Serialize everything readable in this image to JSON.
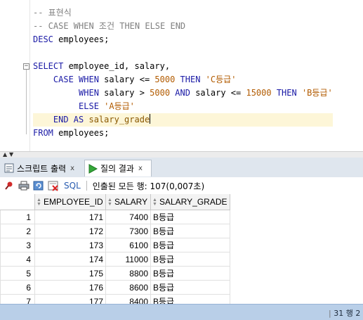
{
  "editor": {
    "lines": [
      [
        {
          "t": "-- 표현식",
          "c": "cm"
        }
      ],
      [
        {
          "t": "-- CASE WHEN 조건 THEN ELSE END",
          "c": "cm"
        }
      ],
      [
        {
          "t": "DESC",
          "c": "kw"
        },
        {
          "t": " employees;",
          "c": "id"
        }
      ],
      [],
      [
        {
          "t": "SELECT",
          "c": "kw"
        },
        {
          "t": " employee_id, salary,",
          "c": "id"
        }
      ],
      [
        {
          "t": "    CASE",
          "c": "kw"
        },
        {
          "t": " WHEN",
          "c": "kw"
        },
        {
          "t": " salary <= ",
          "c": "id"
        },
        {
          "t": "5000",
          "c": "num"
        },
        {
          "t": " THEN",
          "c": "kw"
        },
        {
          "t": " ",
          "c": "id"
        },
        {
          "t": "'C등급'",
          "c": "str"
        }
      ],
      [
        {
          "t": "         WHEN",
          "c": "kw"
        },
        {
          "t": " salary > ",
          "c": "id"
        },
        {
          "t": "5000",
          "c": "num"
        },
        {
          "t": " AND",
          "c": "kw"
        },
        {
          "t": " salary <= ",
          "c": "id"
        },
        {
          "t": "15000",
          "c": "num"
        },
        {
          "t": " THEN",
          "c": "kw"
        },
        {
          "t": " ",
          "c": "id"
        },
        {
          "t": "'B등급'",
          "c": "str"
        }
      ],
      [
        {
          "t": "         ELSE",
          "c": "kw"
        },
        {
          "t": " ",
          "c": "id"
        },
        {
          "t": "'A등급'",
          "c": "str"
        }
      ],
      [
        {
          "t": "    END AS",
          "c": "kw"
        },
        {
          "t": " ",
          "c": "id"
        },
        {
          "t": "salary_grade",
          "c": "kwhl"
        }
      ],
      [
        {
          "t": "FROM",
          "c": "kw"
        },
        {
          "t": " employees;",
          "c": "id"
        }
      ]
    ],
    "highlight_line": 8
  },
  "tabs": [
    {
      "label": "스크립트 출력",
      "close": "x",
      "icon": "script-output-icon"
    },
    {
      "label": "질의 결과",
      "close": "x",
      "icon": "run-triangle-icon"
    }
  ],
  "toolbar": {
    "sql_label": "SQL",
    "fetch_status": "인출된 모든 행: 107(0,007초)",
    "icons": [
      "pin-icon",
      "print-icon",
      "refresh-icon",
      "clear-icon"
    ]
  },
  "grid": {
    "columns": [
      "EMPLOYEE_ID",
      "SALARY",
      "SALARY_GRADE"
    ],
    "rows": [
      {
        "n": "1",
        "id": "171",
        "salary": "7400",
        "grade": "B등급"
      },
      {
        "n": "2",
        "id": "172",
        "salary": "7300",
        "grade": "B등급"
      },
      {
        "n": "3",
        "id": "173",
        "salary": "6100",
        "grade": "B등급"
      },
      {
        "n": "4",
        "id": "174",
        "salary": "11000",
        "grade": "B등급"
      },
      {
        "n": "5",
        "id": "175",
        "salary": "8800",
        "grade": "B등급"
      },
      {
        "n": "6",
        "id": "176",
        "salary": "8600",
        "grade": "B등급"
      },
      {
        "n": "7",
        "id": "177",
        "salary": "8400",
        "grade": "B등급"
      }
    ]
  },
  "status": {
    "text": "31 행 2"
  },
  "colors": {
    "keyword": "#1a1aa6",
    "comment": "#808080",
    "number": "#b25b00",
    "statusbar": "#b9cfe8",
    "tabbar": "#dfe6ee"
  }
}
